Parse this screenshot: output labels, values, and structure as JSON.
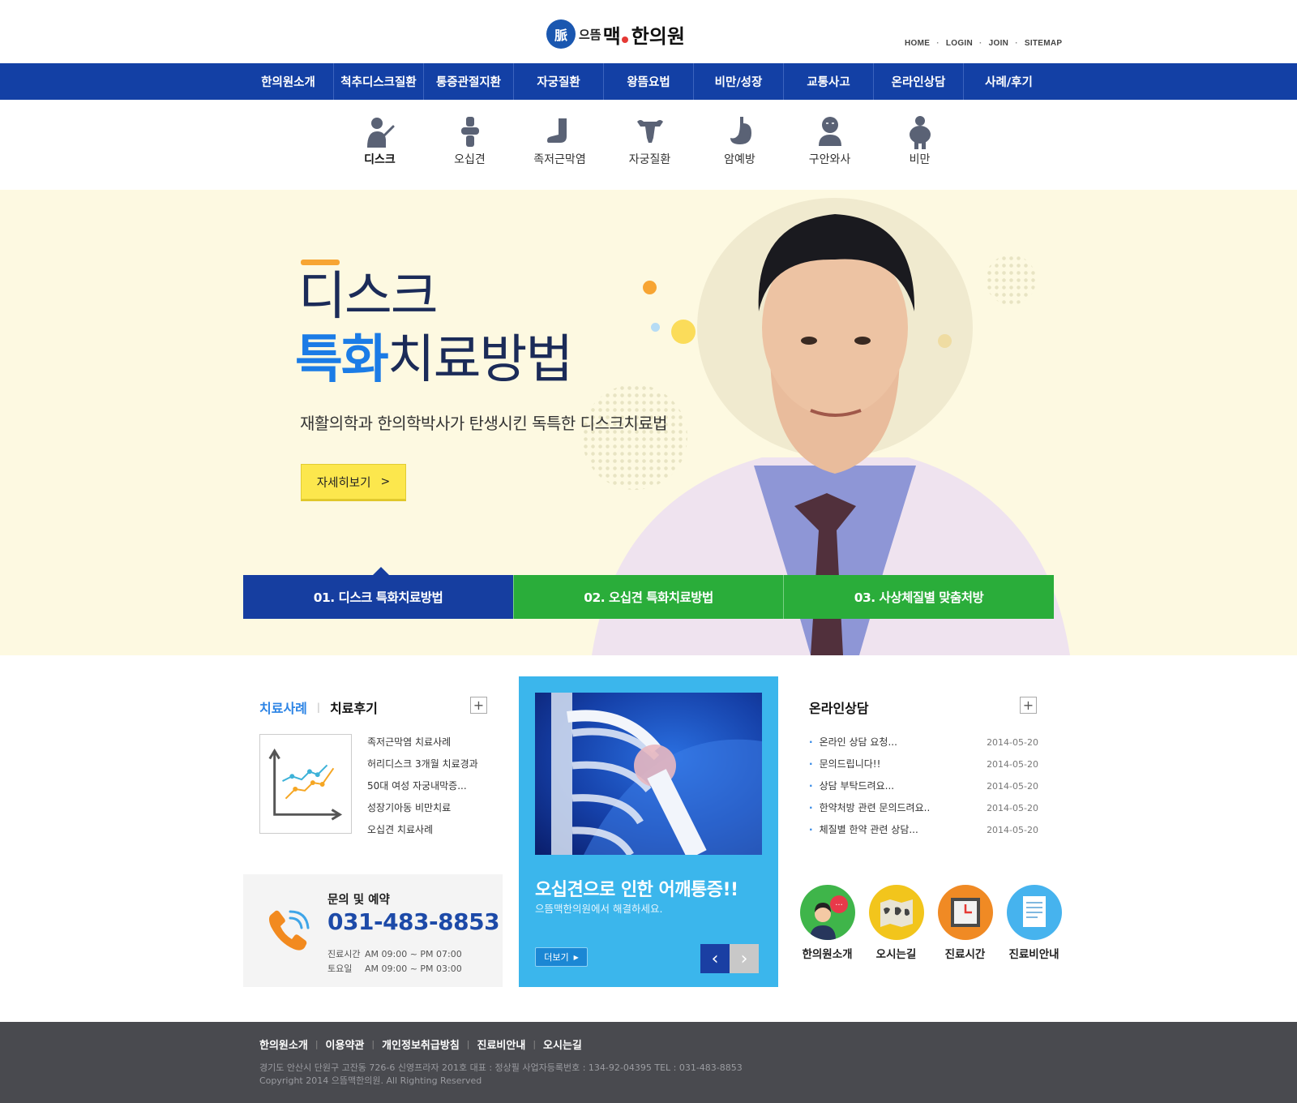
{
  "header": {
    "logo": {
      "seal": "脈",
      "small": "으뜸",
      "big": "맥",
      "name": "한의원"
    },
    "top_links": [
      "HOME",
      "LOGIN",
      "JOIN",
      "SITEMAP"
    ]
  },
  "gnb": [
    "한의원소개",
    "척추디스크질환",
    "통증관절지환",
    "자궁질환",
    "왕뜸요법",
    "비만/성장",
    "교통사고",
    "온라인상담",
    "사례/후기"
  ],
  "sub_icons": [
    {
      "label": "디스크",
      "icon": "disc-patient-icon",
      "active": true
    },
    {
      "label": "오십견",
      "icon": "joint-icon"
    },
    {
      "label": "족저근막염",
      "icon": "foot-icon"
    },
    {
      "label": "자궁질환",
      "icon": "uterus-icon"
    },
    {
      "label": "암예방",
      "icon": "stomach-icon"
    },
    {
      "label": "구안와사",
      "icon": "face-icon"
    },
    {
      "label": "비만",
      "icon": "obesity-icon"
    }
  ],
  "hero": {
    "title_line1": "디스크",
    "title_line2_highlight": "특화",
    "title_line2_rest": "치료방법",
    "subtitle": "재활의학과 한의학박사가 탄생시킨 독특한 디스크치료법",
    "button": "자세히보기",
    "tabs": [
      "01. 디스크 특화치료방법",
      "02. 오십견 특화치료방법",
      "03. 사상체질별 맞춤처방"
    ],
    "active_tab": 0
  },
  "cases": {
    "tab_active": "치료사례",
    "tab_inactive": "치료후기",
    "more": "+",
    "items": [
      "족저근막염 치료사례",
      "허리디스크 3개월 치료경과",
      "50대 여성 자궁내막증...",
      "성장기아동 비만치료",
      "오십견 치료사례"
    ]
  },
  "contact": {
    "label": "문의 및 예약",
    "phone": "031-483-8853",
    "hours": [
      {
        "day": "진료시간",
        "time": "AM 09:00 ~ PM 07:00"
      },
      {
        "day": "토요일",
        "time": "AM 09:00 ~ PM 03:00"
      }
    ]
  },
  "promo": {
    "title": "오십견으로 인한 어깨통증!!",
    "subtitle": "으뜸맥한의원에서 해결하세요.",
    "more": "더보기",
    "prev": "‹",
    "next": "›"
  },
  "consult": {
    "title": "온라인상담",
    "more": "+",
    "items": [
      {
        "title": "온라인 상담 요청...",
        "date": "2014-05-20"
      },
      {
        "title": "문의드립니다!!",
        "date": "2014-05-20"
      },
      {
        "title": "상담 부탁드려요...",
        "date": "2014-05-20"
      },
      {
        "title": "한약처방 관련 문의드려요..",
        "date": "2014-05-20"
      },
      {
        "title": "체질별 한약 관련 상담...",
        "date": "2014-05-20"
      }
    ]
  },
  "quick_links": [
    {
      "label": "한의원소개",
      "color": "#3fb54a"
    },
    {
      "label": "오시는길",
      "color": "#f2c51c"
    },
    {
      "label": "진료시간",
      "color": "#f08a24"
    },
    {
      "label": "진료비안내",
      "color": "#46b3ee"
    }
  ],
  "footer": {
    "links": [
      "한의원소개",
      "이용약관",
      "개인정보취급방침",
      "진료비안내",
      "오시는길"
    ],
    "address": "경기도 안산시 단원구 고잔동 726-6 신영프라자 201호    대표 : 정상필    사업자등록번호 : 134-92-04395     TEL : 031-483-8853",
    "copyright": "Copyright 2014 으뜸맥한의원. All Righting Reserved"
  }
}
